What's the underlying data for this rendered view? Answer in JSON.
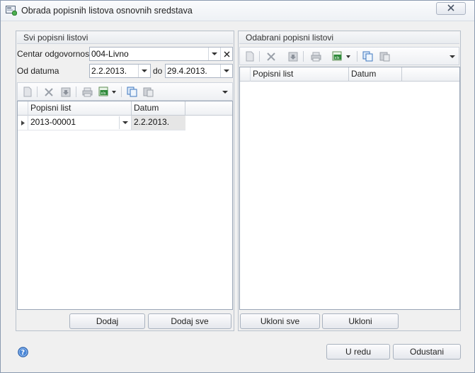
{
  "window": {
    "title": "Obrada popisnih listova osnovnih sredstava",
    "icons": {
      "app": "app-icon",
      "close": "close-icon"
    }
  },
  "left_panel": {
    "caption": "Svi popisni listovi",
    "center_label": "Centar odgovornosti",
    "center_value": "004-Livno",
    "from_label": "Od datuma",
    "from_value": "2.2.2013.",
    "to_label": "do",
    "to_value": "29.4.2013.",
    "toolbar_icons": [
      "new-icon",
      "delete-icon",
      "save-icon",
      "print-icon",
      "excel-export-icon",
      "dropdown-arrow-icon",
      "copy-icon",
      "paste-icon",
      "toolbar-options-icon"
    ],
    "grid": {
      "columns": [
        "Popisni list",
        "Datum"
      ],
      "rows": [
        {
          "popisni_list": "2013-00001",
          "datum": "2.2.2013."
        }
      ]
    },
    "buttons": {
      "add": "Dodaj",
      "add_all": "Dodaj sve"
    }
  },
  "right_panel": {
    "caption": "Odabrani popisni listovi",
    "toolbar_icons": [
      "new-icon",
      "delete-icon",
      "save-icon",
      "print-icon",
      "excel-export-icon",
      "dropdown-arrow-icon",
      "copy-icon",
      "paste-icon",
      "toolbar-options-icon"
    ],
    "grid": {
      "columns": [
        "Popisni list",
        "Datum"
      ],
      "rows": []
    },
    "buttons": {
      "remove_all": "Ukloni sve",
      "remove": "Ukloni"
    }
  },
  "footer": {
    "ok": "U redu",
    "cancel": "Odustani",
    "help_icon": "help-icon"
  }
}
